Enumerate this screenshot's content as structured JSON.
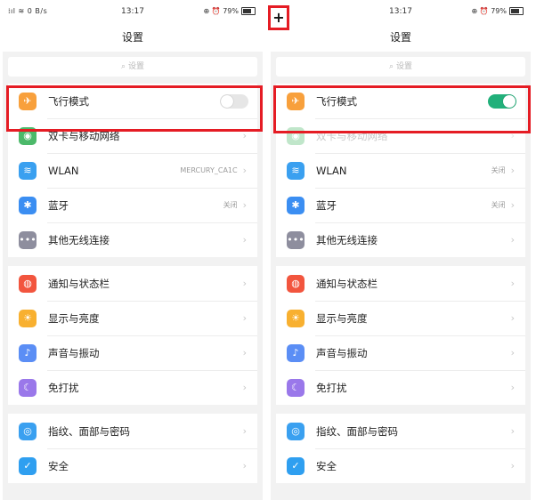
{
  "left": {
    "status": {
      "left": "⁞ıl ≋ 0 B/s",
      "time": "13:17",
      "right": "⊕ ⏰ 79%"
    },
    "title": "设置",
    "search_placeholder": "设置",
    "groups": [
      {
        "items": [
          {
            "label": "飞行模式",
            "toggle": "off",
            "color": "#f8a03c",
            "glyph": "✈"
          },
          {
            "label": "双卡与移动网络",
            "color": "#4cb96a",
            "glyph": "◉"
          },
          {
            "label": "WLAN",
            "value": "MERCURY_CA1C",
            "color": "#3aa0f0",
            "glyph": "≋"
          },
          {
            "label": "蓝牙",
            "value": "关闭",
            "color": "#3b8ef2",
            "glyph": "✱"
          },
          {
            "label": "其他无线连接",
            "color": "#8e8e9e",
            "glyph": "•••"
          }
        ]
      },
      {
        "items": [
          {
            "label": "通知与状态栏",
            "color": "#f2553e",
            "glyph": "◍"
          },
          {
            "label": "显示与亮度",
            "color": "#f8b030",
            "glyph": "☀"
          },
          {
            "label": "声音与振动",
            "color": "#5b8ef5",
            "glyph": "♪"
          },
          {
            "label": "免打扰",
            "color": "#9a78ea",
            "glyph": "☾"
          }
        ]
      },
      {
        "items": [
          {
            "label": "指纹、面部与密码",
            "color": "#3aa0f0",
            "glyph": "◎"
          },
          {
            "label": "安全",
            "color": "#2f9ff0",
            "glyph": "✓"
          }
        ]
      }
    ]
  },
  "right": {
    "status": {
      "left": "",
      "time": "13:17",
      "right": "⊕ ⏰ 79%"
    },
    "title": "设置",
    "search_placeholder": "设置",
    "groups": [
      {
        "items": [
          {
            "label": "飞行模式",
            "toggle": "on",
            "color": "#f8a03c",
            "glyph": "✈"
          },
          {
            "label": "双卡与移动网络",
            "dim": true,
            "color": "#4cb96a",
            "glyph": "◉"
          },
          {
            "label": "WLAN",
            "value": "关闭",
            "color": "#3aa0f0",
            "glyph": "≋"
          },
          {
            "label": "蓝牙",
            "value": "关闭",
            "color": "#3b8ef2",
            "glyph": "✱"
          },
          {
            "label": "其他无线连接",
            "color": "#8e8e9e",
            "glyph": "•••"
          }
        ]
      },
      {
        "items": [
          {
            "label": "通知与状态栏",
            "color": "#f2553e",
            "glyph": "◍"
          },
          {
            "label": "显示与亮度",
            "color": "#f8b030",
            "glyph": "☀"
          },
          {
            "label": "声音与振动",
            "color": "#5b8ef5",
            "glyph": "♪"
          },
          {
            "label": "免打扰",
            "color": "#9a78ea",
            "glyph": "☾"
          }
        ]
      },
      {
        "items": [
          {
            "label": "指纹、面部与密码",
            "color": "#3aa0f0",
            "glyph": "◎"
          },
          {
            "label": "安全",
            "color": "#2f9ff0",
            "glyph": "✓"
          }
        ]
      }
    ]
  },
  "annotation": {
    "plus": "+",
    "highlight_color": "#e51c24"
  }
}
